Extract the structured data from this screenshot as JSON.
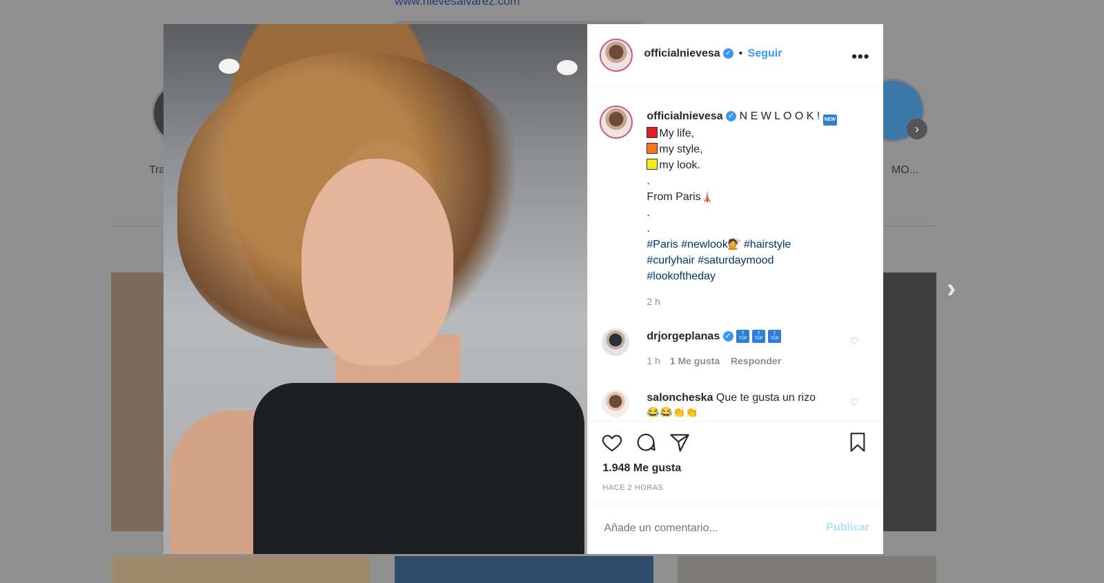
{
  "background": {
    "url_text": "www.nievesalvarez.com",
    "story_left_label": "Tra",
    "story_right_label": "MO..."
  },
  "post": {
    "username": "officialnievesa",
    "follow_label": "Seguir",
    "more_label": "•••",
    "caption_title": "N E W L O O K !",
    "new_badge": "NEW",
    "caption_lines": [
      "My life,",
      "my style,",
      "my look."
    ],
    "dot": ".",
    "from_text": "From Paris",
    "hashtags_line1": [
      "#Paris",
      "#newlook",
      "#hairstyle"
    ],
    "hashtags_line2": [
      "#curlyhair",
      "#saturdaymood"
    ],
    "hashtags_line3": [
      "#lookoftheday"
    ],
    "time": "2 h"
  },
  "comments": [
    {
      "username": "drjorgeplanas",
      "badge": "TOP",
      "time": "1 h",
      "likes": "1 Me gusta",
      "reply": "Responder"
    },
    {
      "username": "saloncheska",
      "text": "Que te gusta un rizo",
      "emojis": "😂😂👏👏"
    }
  ],
  "actions": {
    "likes_count": "1.948 Me gusta",
    "ago": "HACE 2 HORAS"
  },
  "add_comment": {
    "placeholder": "Añade un comentario...",
    "publish_label": "Publicar"
  },
  "colors": {
    "accent": "#3897f0",
    "hashtag": "#00376b",
    "publish_disabled": "#b2dffc"
  }
}
